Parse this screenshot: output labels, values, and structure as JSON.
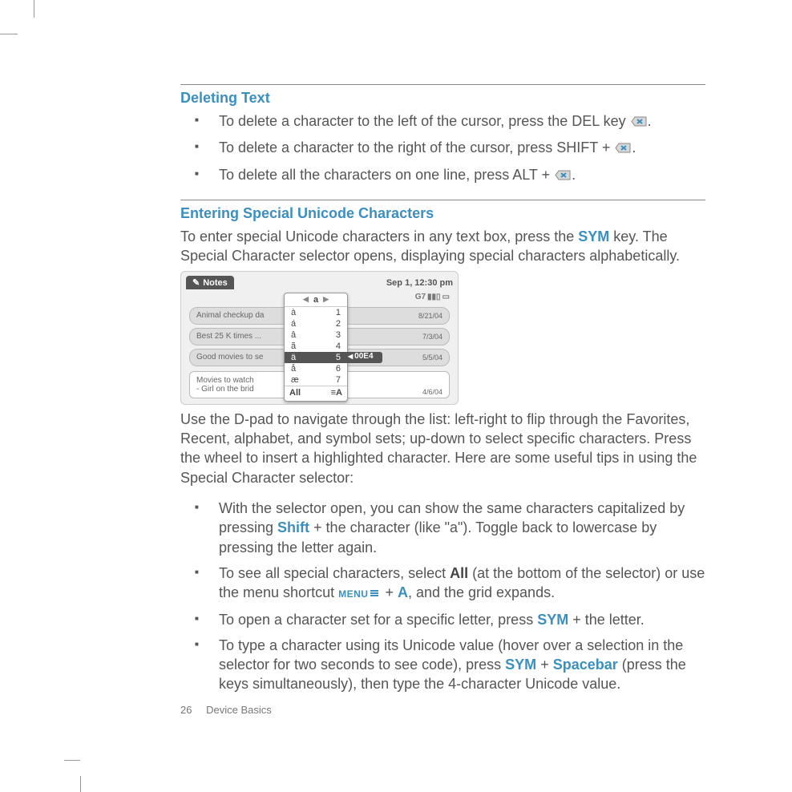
{
  "section1": {
    "title": "Deleting Text",
    "items": [
      {
        "pre": "To delete a character to the left of the cursor, press the DEL key ",
        "post": "."
      },
      {
        "pre": "To delete a character to the right of the cursor, press SHIFT + ",
        "post": "."
      },
      {
        "pre": "To delete all the characters on one line, press ALT + ",
        "post": "."
      }
    ]
  },
  "section2": {
    "title": "Entering Special Unicode Characters",
    "intro_pre": "To enter special Unicode characters in any text box, press the ",
    "intro_key": "SYM",
    "intro_post": " key. The Special Character selector opens, displaying special characters alphabetically.",
    "after_image": "Use the D-pad to navigate through the list: left-right to flip through the Favorites, Recent, alphabet, and symbol sets; up-down to select specific characters. Press the wheel to insert a highlighted character. Here are some useful tips in using the Special Character selector:",
    "tips": {
      "t1a": "With the selector open, you can show the same characters capitalized by pressing ",
      "t1_key": "Shift",
      "t1b": " + the character (like \"a\"). Toggle back to lowercase by pressing the letter again.",
      "t2a": "To see all special characters, select ",
      "t2_bold": "All",
      "t2b": " (at the bottom of the selector) or use the menu shortcut ",
      "t2_menu": "MENU",
      "t2c": " + ",
      "t2_key": "A",
      "t2d": ", and the grid expands.",
      "t3a": "To open a character set for a specific letter, press ",
      "t3_key": "SYM",
      "t3b": " + the letter.",
      "t4a": "To type a character using its Unicode value (hover over a selection in the selector for two seconds to see code), press ",
      "t4_key1": "SYM",
      "t4b": " + ",
      "t4_key2": "Spacebar",
      "t4c": " (press the keys simultaneously), then type the 4-character Unicode value."
    }
  },
  "screenshot": {
    "notes_label": "Notes",
    "date": "Sep 1, 12:30 pm",
    "carrier": "G7",
    "rows": [
      {
        "label": "Animal checkup da",
        "date": "8/21/04"
      },
      {
        "label": "Best 25 K times ...",
        "date": "7/3/04"
      },
      {
        "label": "Good movies to se",
        "date": "5/5/04"
      },
      {
        "label": "Movies to watch\n- Girl on the brid",
        "date": "4/6/04"
      }
    ],
    "popup": {
      "header": "a",
      "rows": [
        {
          "char": "à",
          "num": "1"
        },
        {
          "char": "á",
          "num": "2"
        },
        {
          "char": "â",
          "num": "3"
        },
        {
          "char": "ã",
          "num": "4"
        },
        {
          "char": "ä",
          "num": "5"
        },
        {
          "char": "å",
          "num": "6"
        },
        {
          "char": "æ",
          "num": "7"
        }
      ],
      "code": "00E4",
      "footer_left": "All",
      "footer_right": "≡A"
    }
  },
  "footer": {
    "page": "26",
    "section": "Device Basics"
  }
}
